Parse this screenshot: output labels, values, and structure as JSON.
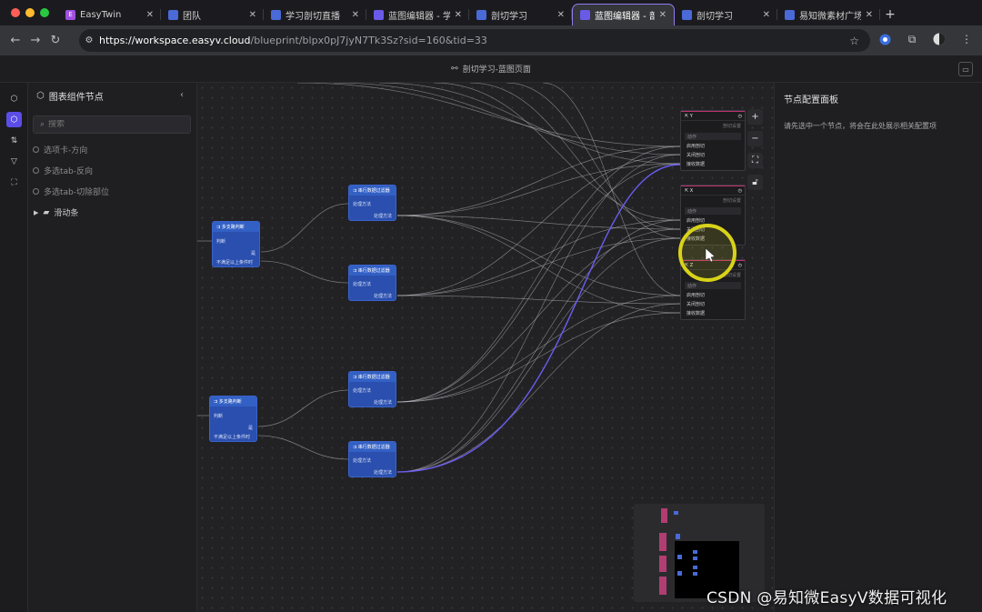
{
  "browser": {
    "tabs": [
      {
        "label": "EasyTwin",
        "icon": "easytwin-e-icon",
        "active": false
      },
      {
        "label": "团队",
        "icon": "easyv-logo-icon",
        "active": false
      },
      {
        "label": "学习剖切直播",
        "icon": "easyv-logo-icon",
        "active": false
      },
      {
        "label": "蓝图编辑器 - 学",
        "icon": "cube-icon",
        "active": false
      },
      {
        "label": "剖切学习",
        "icon": "easyv-logo-icon",
        "active": false
      },
      {
        "label": "蓝图编辑器 - 剖",
        "icon": "cube-icon",
        "active": true
      },
      {
        "label": "剖切学习",
        "icon": "easyv-logo-icon",
        "active": false
      },
      {
        "label": "易知微素材广场",
        "icon": "easyv-logo-icon",
        "active": false
      }
    ],
    "url_host": "https://workspace.easyv.cloud",
    "url_path": "/blueprint/blpx0pJ7jyN7Tk3Sz?sid=160&tid=33"
  },
  "app": {
    "header_title": "剖切学习-蓝图页面"
  },
  "left_panel": {
    "title": "图表组件节点",
    "search_placeholder": "搜索",
    "items": [
      {
        "label": "选项卡-方向",
        "type": "component"
      },
      {
        "label": "多选tab-反向",
        "type": "component"
      },
      {
        "label": "多选tab-切除部位",
        "type": "component"
      },
      {
        "label": "滑动条",
        "type": "folder"
      }
    ]
  },
  "right_panel": {
    "title": "节点配置面板",
    "hint": "请先选中一个节点，将会在此处展示相关配置项"
  },
  "nodes": {
    "branch_title": "多支路判断",
    "branch_in": "判断",
    "branch_yes": "是",
    "branch_no": "不满足以上条件时",
    "filter_title": "串行数据过滤器",
    "filter_in": "处理方法",
    "filter_out": "处理方法",
    "target_sub": "剖切设置",
    "target_action": "动作",
    "target_ops": [
      "启用剖切",
      "关闭剖切",
      "接收数据"
    ],
    "targets": [
      "Y",
      "X",
      "Z"
    ]
  },
  "watermark": "CSDN @易知微EasyV数据可视化",
  "colors": {
    "accent": "#5b4ee8",
    "node_blue": "#2a4fae",
    "target_border": "#c0316f",
    "highlight_ring": "#d8d21a"
  }
}
